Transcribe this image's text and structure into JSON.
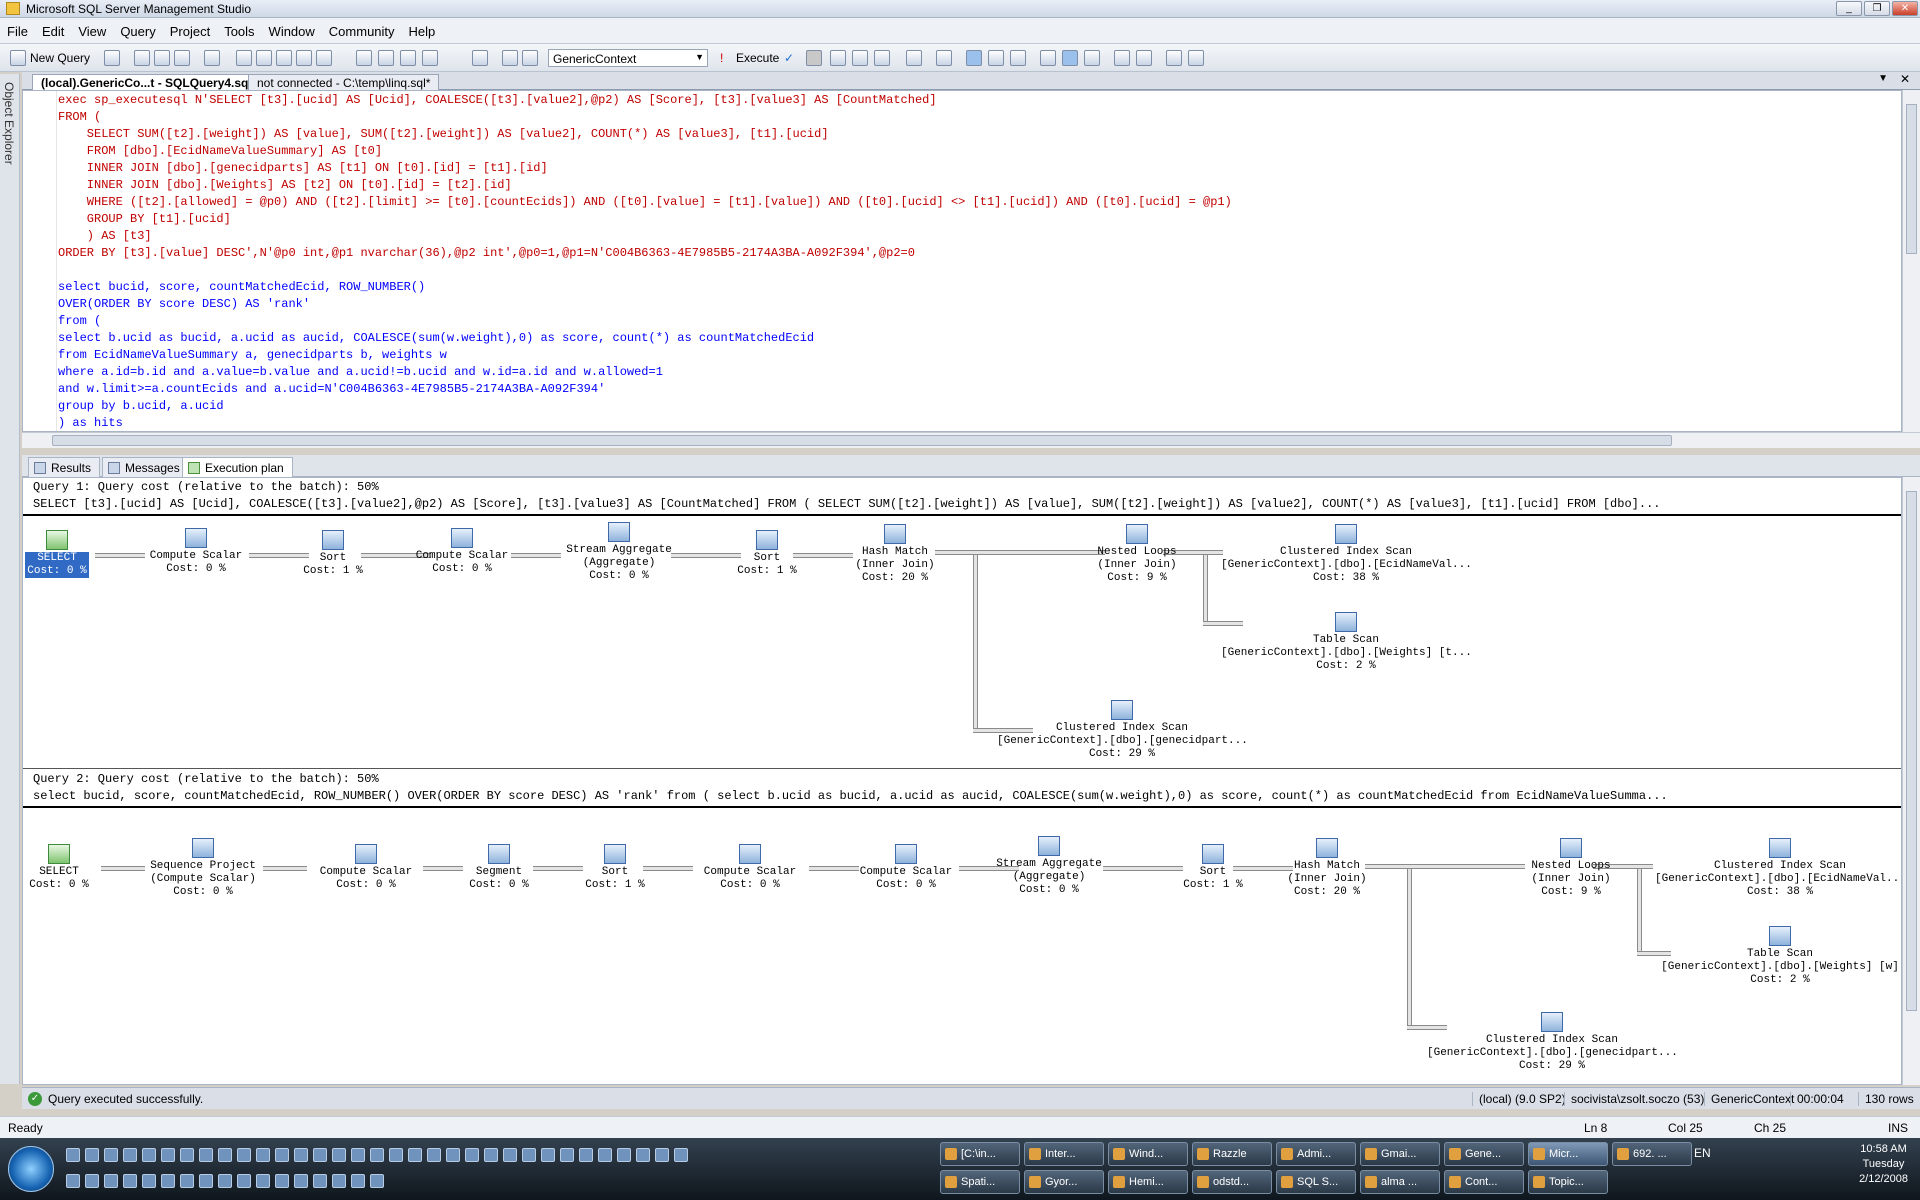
{
  "window": {
    "title": "Microsoft SQL Server Management Studio",
    "buttons": [
      "_",
      "❐",
      "✕"
    ]
  },
  "menu": [
    "File",
    "Edit",
    "View",
    "Query",
    "Project",
    "Tools",
    "Window",
    "Community",
    "Help"
  ],
  "toolbar": {
    "new_query": "New Query",
    "database": "GenericContext",
    "execute": "Execute"
  },
  "object_explorer_label": "Object Explorer",
  "doc_tabs": [
    {
      "label": "(local).GenericCo...t - SQLQuery4.sql*",
      "active": true
    },
    {
      "label": "not connected - C:\\temp\\linq.sql*",
      "active": false
    }
  ],
  "code_lines": [
    {
      "text": "exec sp_executesql N'SELECT [t3].[ucid] AS [Ucid], COALESCE([t3].[value2],@p2) AS [Score], [t3].[value3] AS [CountMatched]"
    },
    {
      "text": "FROM ("
    },
    {
      "text": "    SELECT SUM([t2].[weight]) AS [value], SUM([t2].[weight]) AS [value2], COUNT(*) AS [value3], [t1].[ucid]"
    },
    {
      "text": "    FROM [dbo].[EcidNameValueSummary] AS [t0]"
    },
    {
      "text": "    INNER JOIN [dbo].[genecidparts] AS [t1] ON [t0].[id] = [t1].[id]"
    },
    {
      "text": "    INNER JOIN [dbo].[Weights] AS [t2] ON [t0].[id] = [t2].[id]"
    },
    {
      "text": "    WHERE ([t2].[allowed] = @p0) AND ([t2].[limit] >= [t0].[countEcids]) AND ([t0].[value] = [t1].[value]) AND ([t0].[ucid] <> [t1].[ucid]) AND ([t0].[ucid] = @p1)"
    },
    {
      "text": "    GROUP BY [t1].[ucid]"
    },
    {
      "text": "    ) AS [t3]"
    },
    {
      "text": "ORDER BY [t3].[value] DESC',N'@p0 int,@p1 nvarchar(36),@p2 int',@p0=1,@p1=N'C004B6363-4E7985B5-2174A3BA-A092F394',@p2=0"
    },
    {
      "text": ""
    },
    {
      "text": "select bucid, score, countMatchedEcid, ROW_NUMBER()"
    },
    {
      "text": "OVER(ORDER BY score DESC) AS 'rank'"
    },
    {
      "text": "from ("
    },
    {
      "text": "select b.ucid as bucid, a.ucid as aucid, COALESCE(sum(w.weight),0) as score, count(*) as countMatchedEcid"
    },
    {
      "text": "from EcidNameValueSummary a, genecidparts b, weights w"
    },
    {
      "text": "where a.id=b.id and a.value=b.value and a.ucid!=b.ucid and w.id=a.id and w.allowed=1"
    },
    {
      "text": "and w.limit>=a.countEcids and a.ucid=N'C004B6363-4E7985B5-2174A3BA-A092F394'"
    },
    {
      "text": "group by b.ucid, a.ucid"
    },
    {
      "text": ") as hits"
    }
  ],
  "result_tabs": [
    {
      "label": "Results",
      "active": false
    },
    {
      "label": "Messages",
      "active": false
    },
    {
      "label": "Execution plan",
      "active": true
    }
  ],
  "plan": {
    "q1": {
      "header": "Query 1: Query cost (relative to the batch): 50%",
      "sql": "SELECT [t3].[ucid] AS [Ucid], COALESCE([t3].[value2],@p2) AS [Score], [t3].[value3] AS [CountMatched] FROM ( SELECT SUM([t2].[weight]) AS [value], SUM([t2].[weight]) AS [value2], COUNT(*) AS [value3], [t1].[ucid] FROM [dbo]...",
      "nodes": [
        "SELECT\nCost: 0 %",
        "Compute Scalar\nCost: 0 %",
        "Sort\nCost: 1 %",
        "Compute Scalar\nCost: 0 %",
        "Stream Aggregate\n(Aggregate)\nCost: 0 %",
        "Sort\nCost: 1 %",
        "Hash Match\n(Inner Join)\nCost: 20 %",
        "Nested Loops\n(Inner Join)\nCost: 9 %",
        "Clustered Index Scan\n[GenericContext].[dbo].[EcidNameVal...\nCost: 38 %",
        "Table Scan\n[GenericContext].[dbo].[Weights] [t...\nCost: 2 %",
        "Clustered Index Scan\n[GenericContext].[dbo].[genecidpart...\nCost: 29 %"
      ]
    },
    "q2": {
      "header": "Query 2: Query cost (relative to the batch): 50%",
      "sql": "select bucid, score, countMatchedEcid, ROW_NUMBER() OVER(ORDER BY score DESC) AS 'rank' from ( select b.ucid as bucid, a.ucid as aucid, COALESCE(sum(w.weight),0) as score, count(*) as countMatchedEcid from EcidNameValueSumma...",
      "nodes": [
        "SELECT\nCost: 0 %",
        "Sequence Project\n(Compute Scalar)\nCost: 0 %",
        "Compute Scalar\nCost: 0 %",
        "Segment\nCost: 0 %",
        "Sort\nCost: 1 %",
        "Compute Scalar\nCost: 0 %",
        "Compute Scalar\nCost: 0 %",
        "Stream Aggregate\n(Aggregate)\nCost: 0 %",
        "Sort\nCost: 1 %",
        "Hash Match\n(Inner Join)\nCost: 20 %",
        "Nested Loops\n(Inner Join)\nCost: 9 %",
        "Clustered Index Scan\n[GenericContext].[dbo].[EcidNameVal...\nCost: 38 %",
        "Table Scan\n[GenericContext].[dbo].[Weights] [w]\nCost: 2 %",
        "Clustered Index Scan\n[GenericContext].[dbo].[genecidpart...\nCost: 29 %"
      ]
    }
  },
  "query_status": {
    "message": "Query executed successfully.",
    "server": "(local) (9.0 SP2)",
    "user": "socivista\\zsolt.soczo (53)",
    "db": "GenericContext",
    "time": "00:00:04",
    "rows": "130 rows"
  },
  "statusbar": {
    "ready": "Ready",
    "ln": "Ln 8",
    "col": "Col 25",
    "ch": "Ch 25",
    "ins": "INS"
  },
  "taskbar": {
    "row1": [
      "[C:\\in...",
      "Inter...",
      "Wind...",
      "Razzle",
      "Admi...",
      "Gmai...",
      "Gene...",
      "Micr...",
      "692. ..."
    ],
    "row2": [
      "Spati...",
      "Gyor...",
      "Hemi...",
      "odstd...",
      "SQL S...",
      "alma ...",
      "Cont...",
      "Topic..."
    ],
    "active": "Micr...",
    "lang": "EN",
    "time": "10:58 AM",
    "day": "Tuesday",
    "date": "2/12/2008"
  }
}
